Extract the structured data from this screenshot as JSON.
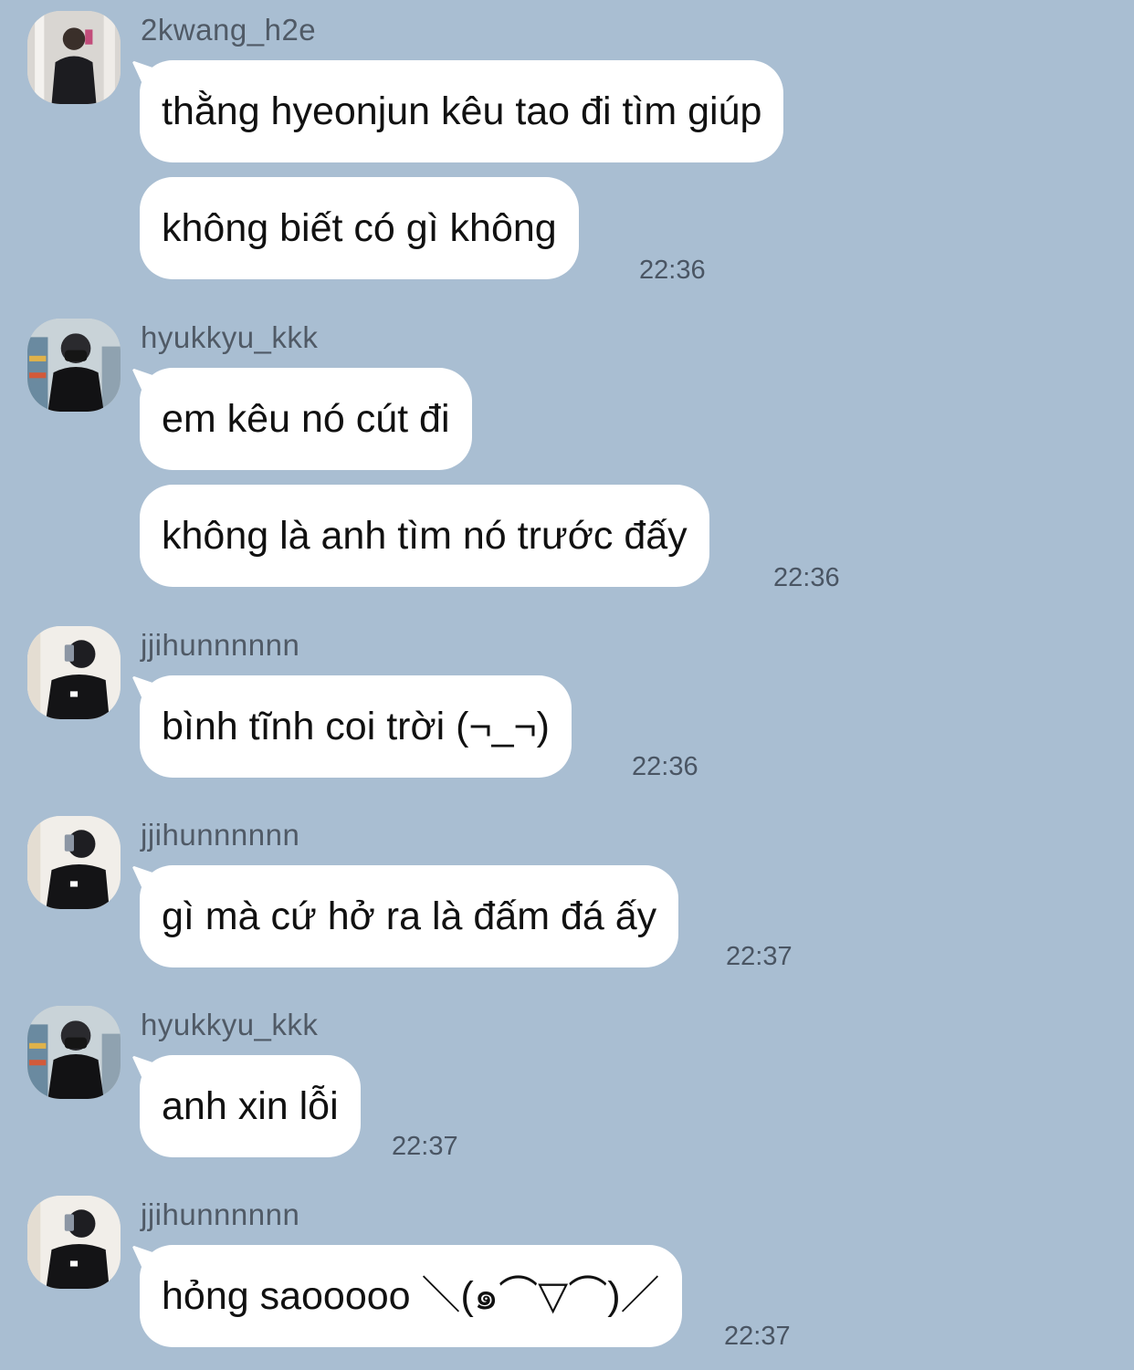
{
  "messages": [
    {
      "username": "2kwang_h2e",
      "avatar": "avatar-2kwang",
      "bubbles": [
        "thằng hyeonjun kêu tao đi tìm giúp",
        "không biết có gì không"
      ],
      "time": "22:36"
    },
    {
      "username": "hyukkyu_kkk",
      "avatar": "avatar-hyukkyu",
      "bubbles": [
        "em kêu nó cút đi",
        "không là anh tìm nó trước đấy"
      ],
      "time": "22:36"
    },
    {
      "username": "jjihunnnnnn",
      "avatar": "avatar-jjihun",
      "bubbles": [
        "bình tĩnh coi trời (¬_¬)"
      ],
      "time": "22:36"
    },
    {
      "username": "jjihunnnnnn",
      "avatar": "avatar-jjihun",
      "bubbles": [
        "gì mà cứ hở ra là đấm đá ấy"
      ],
      "time": "22:37"
    },
    {
      "username": "hyukkyu_kkk",
      "avatar": "avatar-hyukkyu",
      "bubbles": [
        "anh xin lỗi"
      ],
      "time": "22:37"
    },
    {
      "username": "jjihunnnnnn",
      "avatar": "avatar-jjihun",
      "bubbles": [
        "hỏng saooooo ＼(๑⌒▽⌒)／"
      ],
      "time": "22:37"
    }
  ]
}
